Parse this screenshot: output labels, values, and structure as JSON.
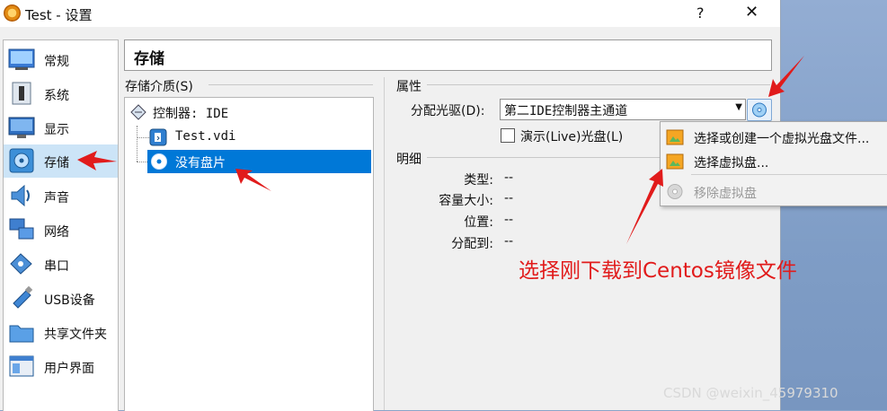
{
  "window": {
    "title": "Test - 设置",
    "help_label": "?",
    "close_label": "✕"
  },
  "sidebar": {
    "items": [
      {
        "label": "常规",
        "icon": "general-icon"
      },
      {
        "label": "系统",
        "icon": "system-icon"
      },
      {
        "label": "显示",
        "icon": "display-icon"
      },
      {
        "label": "存储",
        "icon": "storage-icon",
        "selected": true
      },
      {
        "label": "声音",
        "icon": "audio-icon"
      },
      {
        "label": "网络",
        "icon": "network-icon"
      },
      {
        "label": "串口",
        "icon": "serial-port-icon"
      },
      {
        "label": "USB设备",
        "icon": "usb-icon"
      },
      {
        "label": "共享文件夹",
        "icon": "shared-folder-icon"
      },
      {
        "label": "用户界面",
        "icon": "user-interface-icon"
      }
    ]
  },
  "page": {
    "title": "存储"
  },
  "storage": {
    "media_label": "存储介质(S)",
    "tree": [
      {
        "label": "控制器: IDE",
        "icon": "ide-controller-icon"
      },
      {
        "label": "Test.vdi",
        "icon": "hard-disk-icon"
      },
      {
        "label": "没有盘片",
        "icon": "optical-disc-icon",
        "selected": true
      }
    ]
  },
  "attributes": {
    "heading": "属性",
    "drive_label": "分配光驱(D):",
    "drive_value": "第二IDE控制器主通道",
    "live_cd_label": "演示(Live)光盘(L)",
    "live_cd_checked": false
  },
  "details": {
    "heading": "明细",
    "rows": [
      {
        "key": "类型:",
        "value": "--"
      },
      {
        "key": "容量大小:",
        "value": "--"
      },
      {
        "key": "位置:",
        "value": "--"
      },
      {
        "key": "分配到:",
        "value": "--"
      }
    ]
  },
  "popup_menu": {
    "items": [
      {
        "label": "选择或创建一个虚拟光盘文件...",
        "enabled": true
      },
      {
        "label": "选择虚拟盘...",
        "enabled": true
      },
      {
        "label": "移除虚拟盘",
        "enabled": false
      }
    ]
  },
  "annotation": {
    "text": "选择刚下载到Centos镜像文件",
    "color": "#e11b1b"
  },
  "watermark": {
    "text": "CSDN @weixin_45979310"
  },
  "colors": {
    "selection": "#0078d7",
    "sidebar_selected": "#cce4f7",
    "window_bg": "#f0f0f0"
  }
}
